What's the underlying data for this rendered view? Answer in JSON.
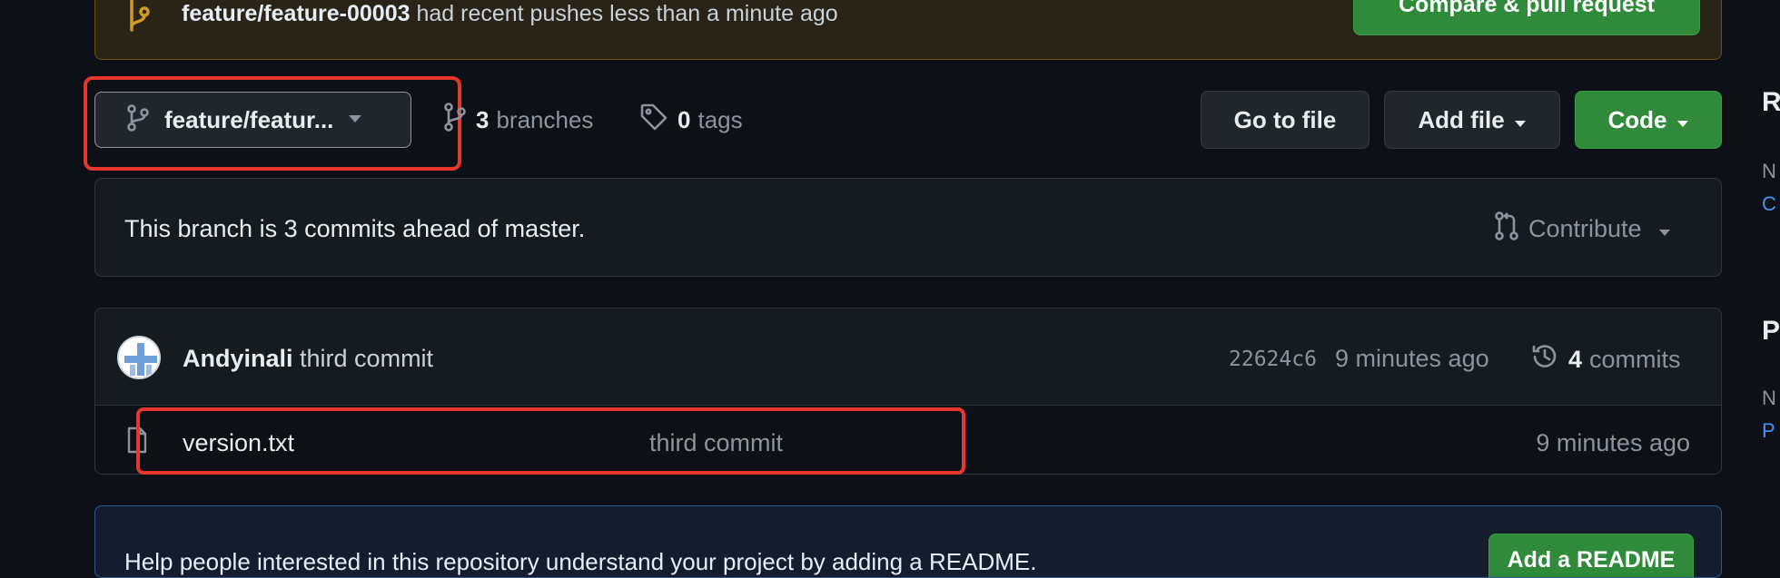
{
  "banner": {
    "branch": "feature/feature-00003",
    "message": "had recent pushes less than a minute ago",
    "button": "Compare & pull request"
  },
  "toolbar": {
    "branch_selector": "feature/featur...",
    "branches_count": "3",
    "branches_label": "branches",
    "tags_count": "0",
    "tags_label": "tags",
    "go_to_file": "Go to file",
    "add_file": "Add file",
    "code": "Code"
  },
  "ahead": {
    "text": "This branch is 3 commits ahead of master.",
    "contribute": "Contribute"
  },
  "latest_commit": {
    "author": "Andyinali",
    "message": "third commit",
    "sha": "22624c6",
    "time": "9 minutes ago",
    "commits_count": "4",
    "commits_label": "commits"
  },
  "files": [
    {
      "name": "version.txt",
      "message": "third commit",
      "time": "9 minutes ago"
    }
  ],
  "readme": {
    "text": "Help people interested in this repository understand your project by adding a README.",
    "button": "Add a README"
  },
  "sidebar": {
    "heading1": "R",
    "text1": "N",
    "link1": "C",
    "heading2": "P",
    "text2": "N",
    "link2": "P"
  },
  "colors": {
    "background": "#0d1117",
    "accent_green": "#2f8a3a",
    "highlight_red": "#e5372b",
    "link_blue": "#4493f8",
    "banner_icon": "#d29922"
  }
}
